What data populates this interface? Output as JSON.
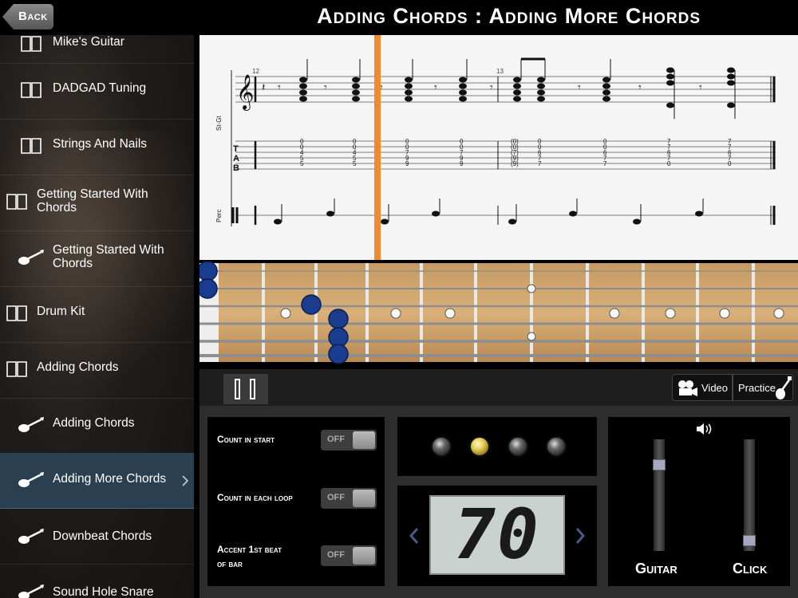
{
  "header": {
    "back_label": "Back",
    "title": "Adding Chords : Adding More Chords"
  },
  "sidebar": {
    "items": [
      {
        "label": "Mike's Guitar",
        "icon": "book-icon"
      },
      {
        "label": "DADGAD Tuning",
        "icon": "book-icon"
      },
      {
        "label": "Strings And Nails",
        "icon": "book-icon"
      },
      {
        "label": "Getting Started With Chords",
        "icon": "book-icon"
      },
      {
        "label": "Getting Started With Chords",
        "icon": "guitar-icon"
      },
      {
        "label": "Drum Kit",
        "icon": "book-icon"
      },
      {
        "label": "Adding Chords",
        "icon": "book-icon"
      },
      {
        "label": "Adding Chords",
        "icon": "guitar-icon"
      },
      {
        "label": "Adding More Chords",
        "icon": "guitar-icon",
        "selected": true
      },
      {
        "label": "Downbeat Chords",
        "icon": "guitar-icon"
      },
      {
        "label": "Sound Hole Snare",
        "icon": "guitar-icon"
      }
    ]
  },
  "notation": {
    "instrument_1": "St-Gt",
    "instrument_2": "Perc",
    "bar_number_1": "12",
    "bar_number_2": "13",
    "tab_letters": [
      "T",
      "A",
      "B"
    ]
  },
  "toolbar": {
    "video_label": "Video",
    "practice_label": "Practice"
  },
  "settings": {
    "count_in_start": {
      "label": "Count in start",
      "value": "OFF"
    },
    "count_in_each_loop": {
      "label": "Count in each loop",
      "value": "OFF"
    },
    "accent_first_beat": {
      "label_line1": "Accent 1st beat",
      "label_line2": "of bar",
      "value": "OFF"
    }
  },
  "metronome": {
    "active_light_index": 1,
    "tempo": "70"
  },
  "mixer": {
    "guitar_label": "Guitar",
    "click_label": "Click",
    "guitar_level": 0.8,
    "click_level": 0.05
  },
  "colors": {
    "cursor": "#f08a2e",
    "selected_item": "#2a4050",
    "finger_dot": "#1a3c8f"
  }
}
